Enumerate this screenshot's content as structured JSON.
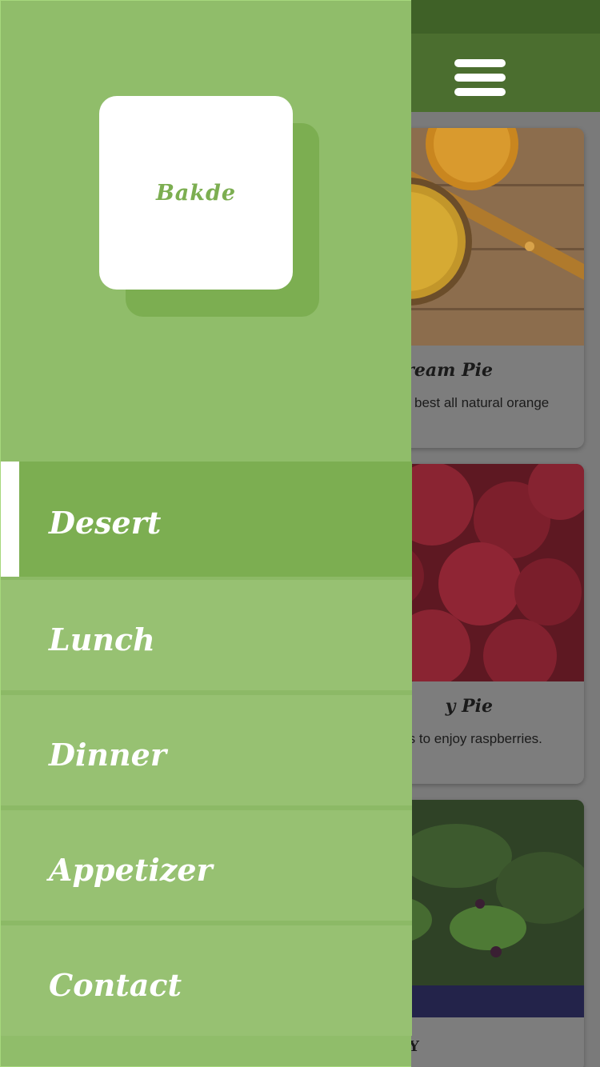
{
  "app": {
    "cards": [
      {
        "title": "Cream Pie",
        "description": "best all natural orange"
      },
      {
        "title": "y Pie",
        "description": "rs to enjoy raspberries."
      },
      {
        "title": "Y"
      }
    ]
  },
  "drawer": {
    "logo": "Bakde",
    "items": [
      {
        "label": "Desert",
        "active": true
      },
      {
        "label": "Lunch"
      },
      {
        "label": "Dinner"
      },
      {
        "label": "Appetizer"
      },
      {
        "label": "Contact"
      }
    ]
  },
  "colors": {
    "drawer_bg": "#90bd6a",
    "accent": "#7cae51",
    "menu_item": "#97c172",
    "top_bar_dimmed": "#4b6e2f"
  },
  "icons": {
    "menu": "hamburger-icon"
  }
}
